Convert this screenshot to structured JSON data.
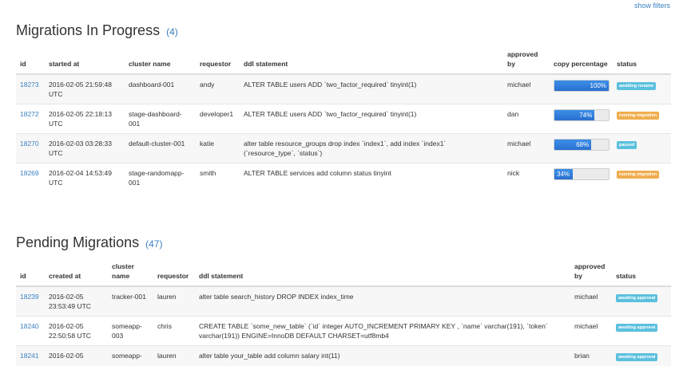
{
  "header": {
    "show_filters": "show filters"
  },
  "in_progress": {
    "title": "Migrations In Progress",
    "count": "(4)",
    "columns": [
      "id",
      "started at",
      "cluster name",
      "requestor",
      "ddl statement",
      "approved by",
      "copy percentage",
      "status"
    ],
    "rows": [
      {
        "id": "18273",
        "started_at": "2016-02-05 21:59:48 UTC",
        "cluster": "dashboard-001",
        "requestor": "andy",
        "ddl": "ALTER TABLE users ADD `two_factor_required` tinyint(1)",
        "approved_by": "michael",
        "percent": 100,
        "percent_label": "100%",
        "status": "awaiting rename",
        "status_color": "#5bc0de"
      },
      {
        "id": "18272",
        "started_at": "2016-02-05 22:18:13 UTC",
        "cluster": "stage-dashboard-001",
        "requestor": "developer1",
        "ddl": "ALTER TABLE users ADD `two_factor_required` tinyint(1)",
        "approved_by": "dan",
        "percent": 74,
        "percent_label": "74%",
        "status": "running migration",
        "status_color": "#f0ad4e"
      },
      {
        "id": "18270",
        "started_at": "2016-02-03 03:28:33 UTC",
        "cluster": "default-cluster-001",
        "requestor": "katie",
        "ddl": "alter table resource_groups drop index `index1`, add index `index1` (`resource_type`, `status`)",
        "approved_by": "michael",
        "percent": 68,
        "percent_label": "68%",
        "status": "paused",
        "status_color": "#5bc0de"
      },
      {
        "id": "18269",
        "started_at": "2016-02-04 14:53:49 UTC",
        "cluster": "stage-randomapp-001",
        "requestor": "smith",
        "ddl": "ALTER TABLE services add column status tinyint",
        "approved_by": "nick",
        "percent": 34,
        "percent_label": "34%",
        "status": "running migration",
        "status_color": "#f0ad4e"
      }
    ]
  },
  "pending": {
    "title": "Pending Migrations",
    "count": "(47)",
    "columns": [
      "id",
      "created at",
      "cluster name",
      "requestor",
      "ddl statement",
      "approved by",
      "status"
    ],
    "rows": [
      {
        "id": "18239",
        "created_at": "2016-02-05 23:53:49 UTC",
        "cluster": "tracker-001",
        "requestor": "lauren",
        "ddl": "alter table search_history DROP INDEX index_time",
        "approved_by": "michael",
        "status": "awaiting approval",
        "status_color": "#5bc0de"
      },
      {
        "id": "18240",
        "created_at": "2016-02-05 22:50:58 UTC",
        "cluster": "someapp-003",
        "requestor": "chris",
        "ddl": "CREATE TABLE `some_new_table` (`id` integer AUTO_INCREMENT PRIMARY KEY , `name` varchar(191), `token` varchar(191)) ENGINE=InnoDB DEFAULT CHARSET=utf8mb4",
        "approved_by": "michael",
        "status": "awaiting approval",
        "status_color": "#5bc0de"
      },
      {
        "id": "18241",
        "created_at": "2016-02-05",
        "cluster": "someapp-",
        "requestor": "lauren",
        "ddl": "alter table your_table add column salary int(11)",
        "approved_by": "brian",
        "status": "awaiting approval",
        "status_color": "#5bc0de"
      }
    ]
  }
}
